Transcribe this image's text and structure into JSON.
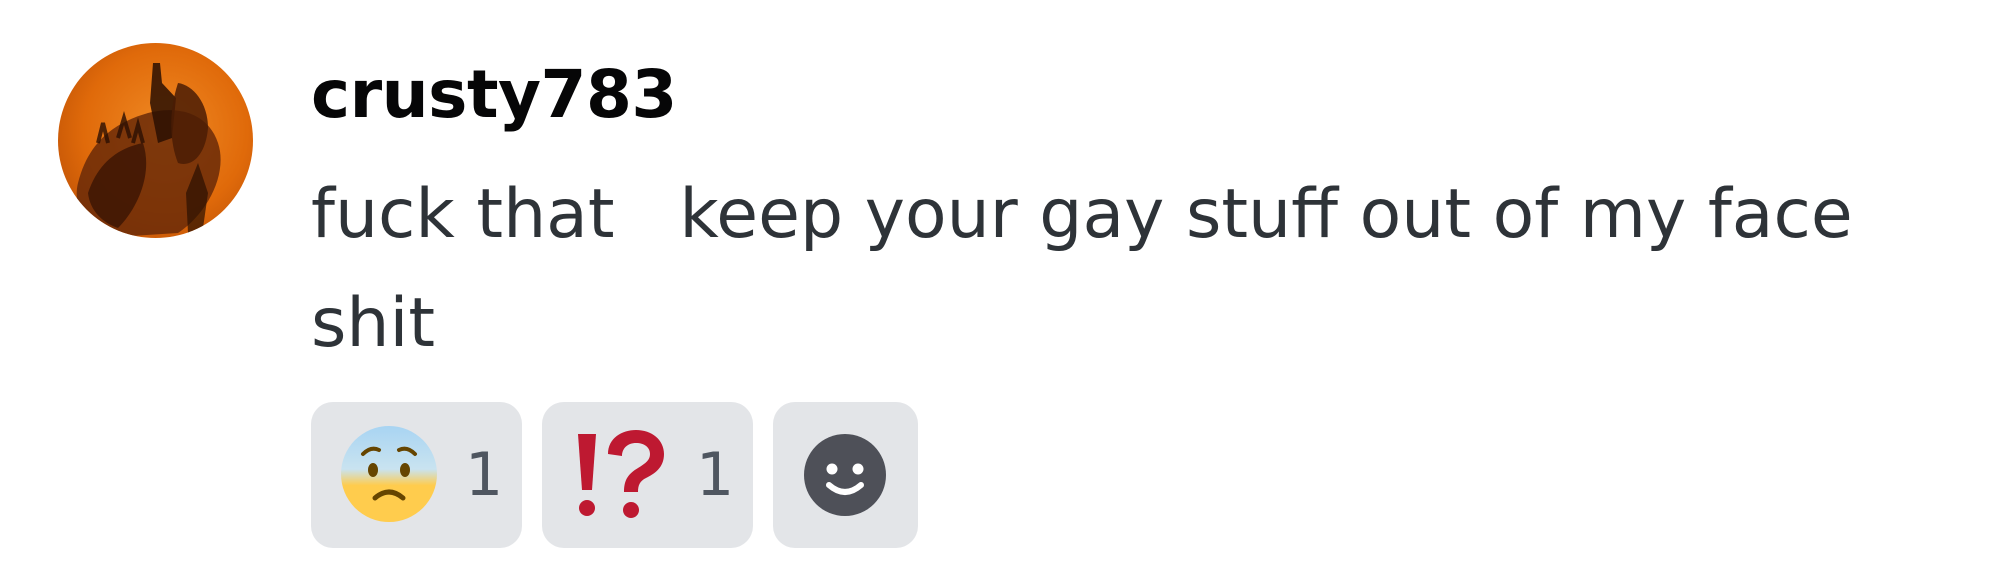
{
  "message": {
    "author": "crusty783",
    "avatar_icon": "user-avatar-image",
    "content": "fuck that   keep your gay stuff out of my face shit"
  },
  "reactions": [
    {
      "emoji": "anxious-face-with-sweat",
      "count": "1"
    },
    {
      "emoji": "exclamation-question-mark",
      "count": "1"
    }
  ],
  "add_reaction": {
    "icon": "smiley-add-reaction-icon"
  },
  "colors": {
    "username": "#060607",
    "text": "#2e3338",
    "reaction_bg": "#e3e5e8",
    "reaction_count": "#4f5660",
    "exclamation_red": "#be1931",
    "avatar_orange": "#e8740f"
  }
}
